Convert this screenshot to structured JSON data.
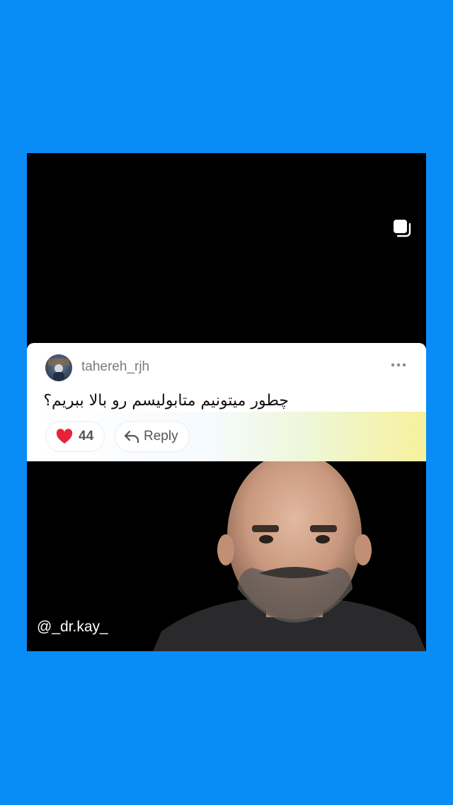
{
  "comment": {
    "username": "tahereh_rjh",
    "text": "چطور میتونیم متابولیسم رو بالا ببریم؟",
    "like_count": "44",
    "reply_label": "Reply"
  },
  "overlay": {
    "handle": "@_dr.kay_"
  },
  "icons": {
    "multi": "carousel-icon",
    "more": "more-options-icon",
    "like": "heart-icon",
    "reply": "reply-arrow-icon"
  },
  "colors": {
    "background": "#0a8cf7",
    "heart": "#e8213a"
  }
}
